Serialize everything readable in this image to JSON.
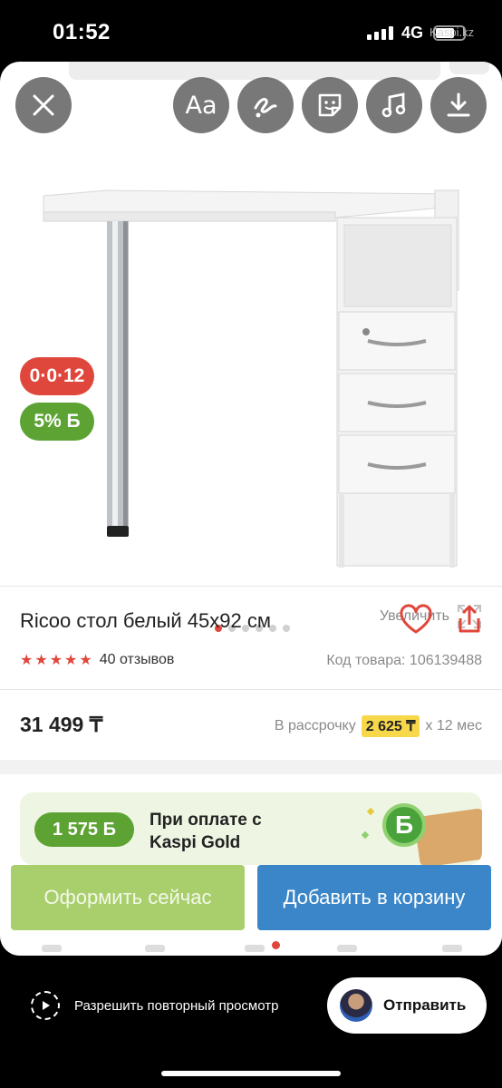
{
  "status": {
    "time": "01:52",
    "network": "4G",
    "site": "Kaspi.kz"
  },
  "story_tools": {
    "close": "close-icon",
    "text": "Aa",
    "draw": "squiggle-icon",
    "sticker": "sticker-icon",
    "music": "music-note-icon",
    "download": "download-icon"
  },
  "badges": {
    "installment": "0·0·12",
    "bonus": "5% Б"
  },
  "gallery": {
    "zoom_label": "Увеличить",
    "image_count": 6,
    "active_index": 0
  },
  "product": {
    "title": "Ricoo стол белый 45x92 см",
    "rating": 5,
    "reviews": "40 отзывов",
    "code": "Код товара: 106139488",
    "price": "31 499 ₸",
    "installment_prefix": "В рассрочку",
    "installment_amount": "2 625 ₸",
    "installment_suffix": "х 12 мес"
  },
  "kaspi_gold": {
    "bonus": "1 575 Б",
    "text_line1": "При оплате с",
    "text_line2": "Kaspi Gold",
    "coin": "Б"
  },
  "actions": {
    "buy_now": "Оформить сейчас",
    "add_to_cart": "Добавить в корзину"
  },
  "bottom": {
    "replay_label": "Разрешить повторный просмотр",
    "send_label": "Отправить"
  },
  "colors": {
    "kaspi_red": "#e0473c",
    "kaspi_green": "#5da334",
    "cart_blue": "#3b86c8",
    "buy_green": "#a9cf6c",
    "highlight": "#f7d84a"
  }
}
